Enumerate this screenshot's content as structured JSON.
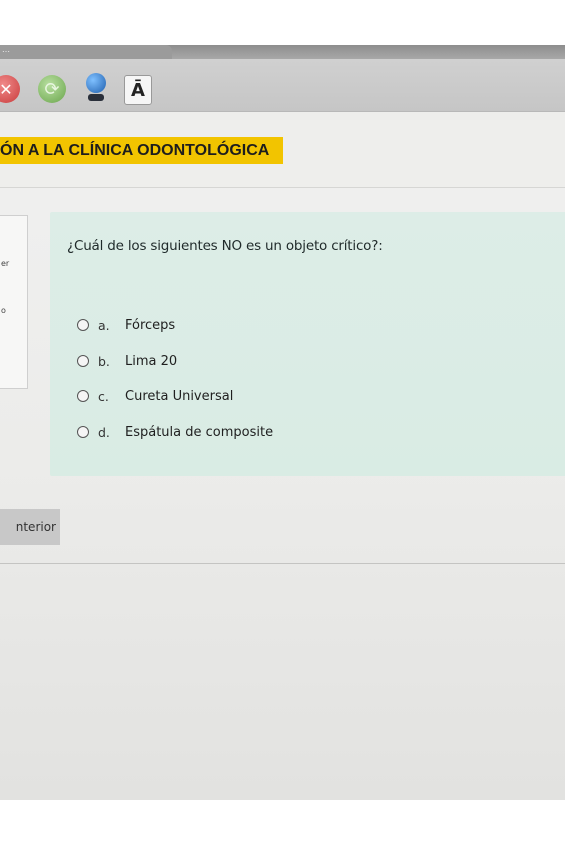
{
  "browser": {
    "tab_label": "…",
    "icons": [
      "stop-icon",
      "reload-icon",
      "globe-icon",
      "text-size-icon"
    ],
    "text_size_glyph": "Ā"
  },
  "course": {
    "title": "ÓN A LA CLÍNICA ODONTOLÓGICA",
    "title_bg": "#f2c400"
  },
  "side_panel": {
    "fragment_1": "er",
    "fragment_2": "o"
  },
  "question": {
    "text": "¿Cuál de los siguientes NO es un objeto crítico?:",
    "options": [
      {
        "letter": "a.",
        "text": "Fórceps"
      },
      {
        "letter": "b.",
        "text": "Lima 20"
      },
      {
        "letter": "c.",
        "text": "Cureta Universal"
      },
      {
        "letter": "d.",
        "text": "Espátula de composite"
      }
    ],
    "box_color": "#dbede6"
  },
  "navigation": {
    "previous_label": "nterior"
  }
}
